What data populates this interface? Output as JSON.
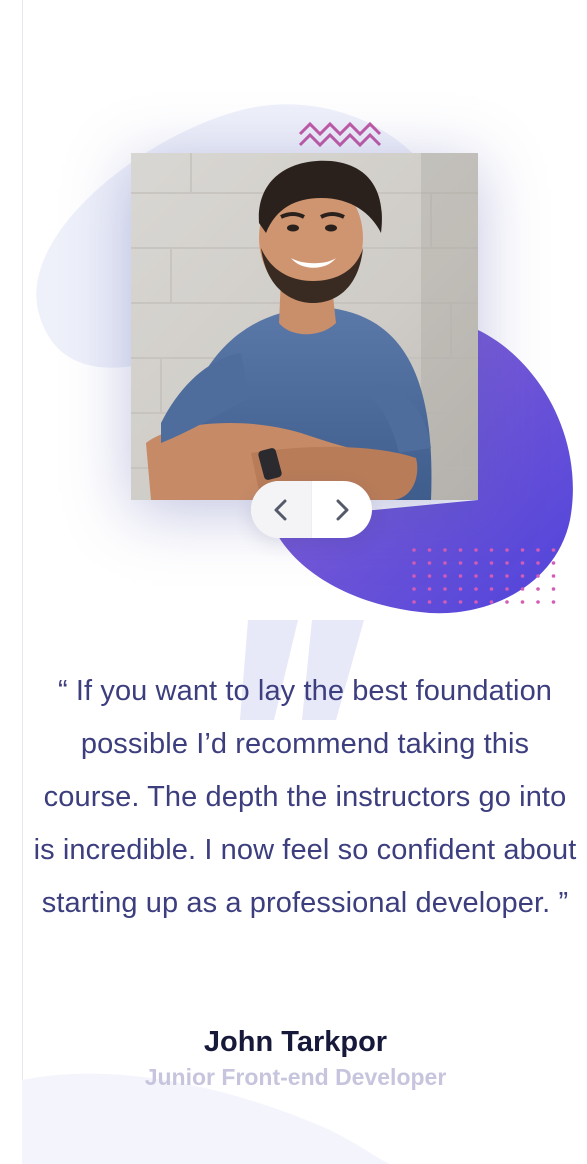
{
  "testimonial": {
    "quote": "“ If you want to lay the best foundation possible I’d recommend taking this course. The depth the instructors go into is incredible. I now feel so confident about starting up as a professional developer. ”",
    "author_name": "John Tarkpor",
    "author_role": "Junior Front-end Developer"
  },
  "slider": {
    "prev_icon": "chevron-left-icon",
    "next_icon": "chevron-right-icon"
  },
  "colors": {
    "quote_text": "#3c3e7e",
    "author_name": "#17193a",
    "author_role": "#c6c5dd",
    "accent_purple": "#6a4fd8",
    "accent_pink": "#c64fa8"
  }
}
